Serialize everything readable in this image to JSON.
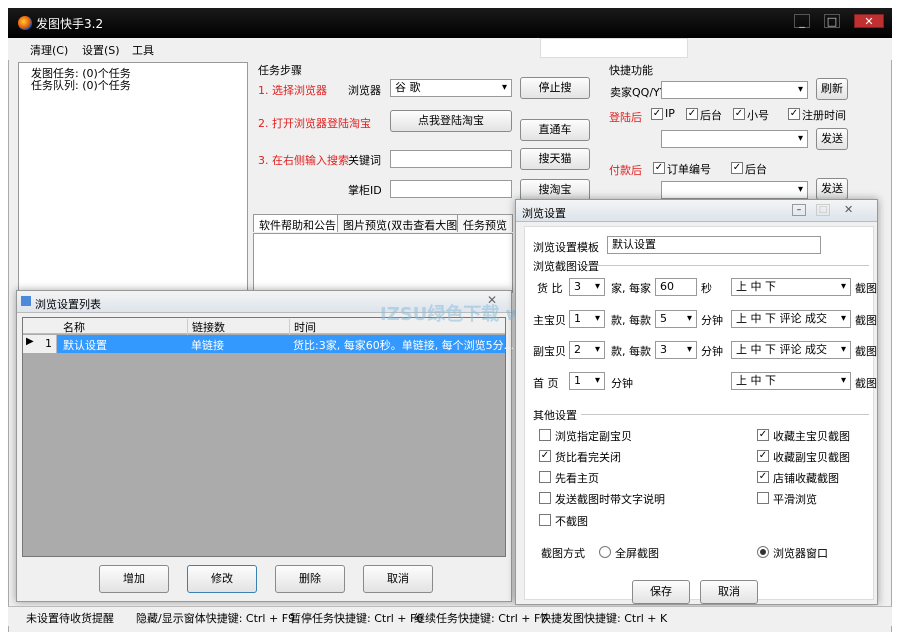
{
  "window": {
    "title": "发图快手3.2",
    "min": "_",
    "max": "□",
    "close": "✕"
  },
  "menu": {
    "items": [
      "清理(C)",
      "设置(S)",
      "工具"
    ]
  },
  "tree": {
    "item1": "发图任务: (0)个任务",
    "item2": "任务队列: (0)个任务"
  },
  "steps": {
    "group_title": "任务步骤",
    "step1": "1. 选择浏览器",
    "step2": "2. 打开浏览器登陆淘宝",
    "step3": "3. 在右侧输入搜索",
    "browser_label": "浏览器",
    "browser_value": "谷 歌",
    "keyword_label": "关键词",
    "keyword_value": "",
    "shop_label": "掌柜ID",
    "shop_value": "",
    "stop_button": "停止搜",
    "login_button": "点我登陆淘宝",
    "direct_button": "直通车",
    "tmall_button": "搜天猫",
    "taobao_button": "搜淘宝"
  },
  "tabs": [
    "软件帮助和公告",
    "图片预览(双击查看大图)",
    "任务预览"
  ],
  "quick": {
    "group_title": "快捷功能",
    "seller_label": "卖家QQ/YY",
    "refresh_button": "刷新",
    "after_login_label": "登陆后",
    "ip": "IP",
    "ip_checked": true,
    "backend": "后台",
    "backend_checked": true,
    "small": "小号",
    "small_checked": true,
    "regtime": "注册时间",
    "regtime_checked": true,
    "send1_button": "发送",
    "after_pay_label": "付款后",
    "order": "订单编号",
    "order_checked": true,
    "backend2": "后台",
    "backend2_checked": true,
    "send2_button": "发送"
  },
  "list_dialog": {
    "title": "浏览设置列表",
    "columns": [
      "名称",
      "链接数",
      "时间"
    ],
    "rows": [
      {
        "index": "1",
        "name": "默认设置",
        "links": "单链接",
        "time": "货比:3家, 每家60秒。单链接, 每个浏览5分..."
      }
    ],
    "add_button": "增加",
    "edit_button": "修改",
    "delete_button": "删除",
    "cancel_button": "取消"
  },
  "settings_dialog": {
    "title": "浏览设置",
    "template_label": "浏览设置模板",
    "template_value": "默认设置",
    "capture_group": "浏览截图设置",
    "row1": {
      "label": "货 比",
      "count": "3",
      "unit1": "家, 每家",
      "seconds": "60",
      "unit2": "秒",
      "order": "上 中 下",
      "capture": "截图"
    },
    "row2": {
      "label": "主宝贝",
      "count": "1",
      "unit1": "款, 每款",
      "minutes": "5",
      "unit2": "分钟",
      "order": "上 中 下 评论 成交",
      "capture": "截图"
    },
    "row3": {
      "label": "副宝贝",
      "count": "2",
      "unit1": "款, 每款",
      "minutes": "3",
      "unit2": "分钟",
      "order": "上 中 下 评论 成交",
      "capture": "截图"
    },
    "row4": {
      "label": "首 页",
      "count": "1",
      "unit2": "分钟",
      "order": "上 中 下",
      "capture": "截图"
    },
    "other_group": "其他设置",
    "opts": [
      {
        "label": "浏览指定副宝贝",
        "checked": false
      },
      {
        "label": "货比看完关闭",
        "checked": true
      },
      {
        "label": "先看主页",
        "checked": false
      },
      {
        "label": "发送截图时带文字说明",
        "checked": false
      },
      {
        "label": "不截图",
        "checked": false
      }
    ],
    "opts_right": [
      {
        "label": "收藏主宝贝截图",
        "checked": true
      },
      {
        "label": "收藏副宝贝截图",
        "checked": true
      },
      {
        "label": "店铺收藏截图",
        "checked": true
      },
      {
        "label": "平滑浏览",
        "checked": false
      }
    ],
    "capture_mode_label": "截图方式",
    "mode_full": "全屏截图",
    "mode_window": "浏览器窗口",
    "save_button": "保存",
    "cancel_button": "取消"
  },
  "watermark": "IZSU绿色下载 www.iz5u.com",
  "status": {
    "s1": "未设置待收货提醒",
    "s2": "隐藏/显示窗体快捷键: Ctrl + F9",
    "s3": "暂停任务快捷键: Ctrl + F6",
    "s4": "继续任务快捷键: Ctrl + F7",
    "s5": "快捷发图快捷键: Ctrl + K"
  }
}
